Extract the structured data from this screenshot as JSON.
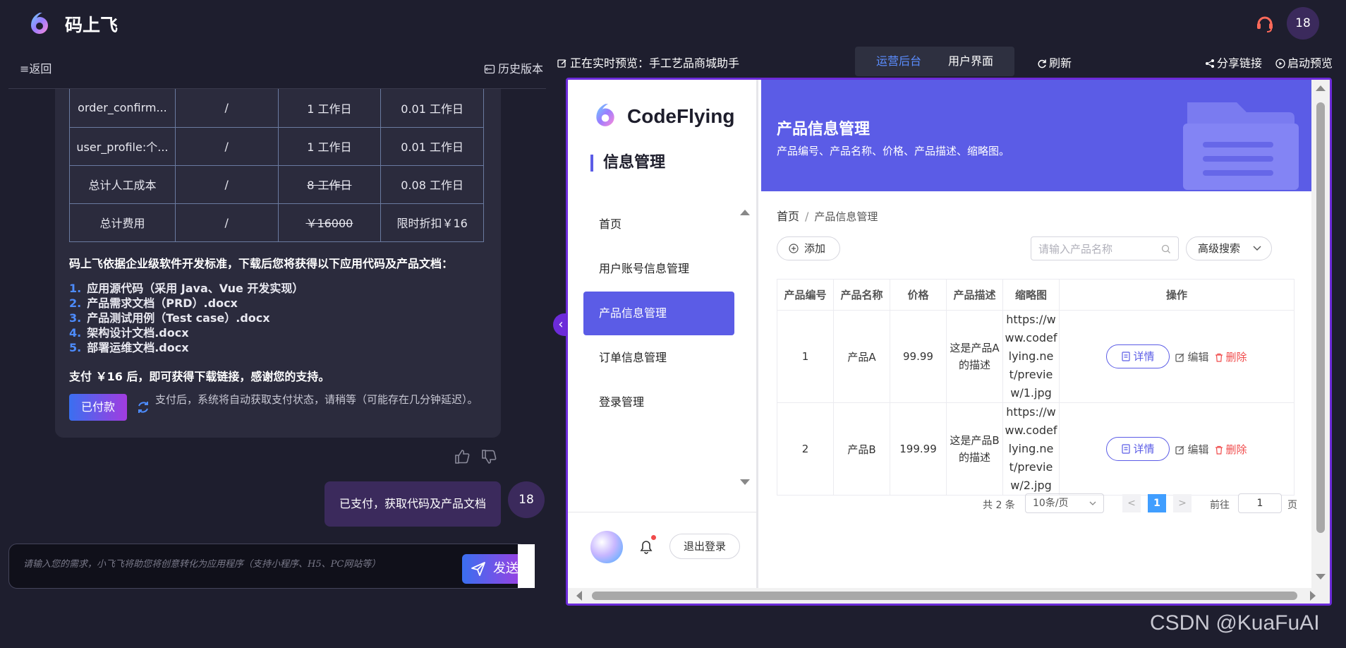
{
  "app": {
    "brand": "码上飞",
    "user_badge": "18"
  },
  "left_panel": {
    "back_label": "≡返回",
    "history_label": "历史版本",
    "cost_table": [
      [
        "order_confirm...",
        "/",
        "1 工作日",
        "0.01 工作日"
      ],
      [
        "user_profile:个...",
        "/",
        "1 工作日",
        "0.01 工作日"
      ],
      [
        "总计人工成本",
        "/",
        "8 工作日",
        "0.08 工作日"
      ],
      [
        "总计费用",
        "/",
        "￥16000",
        "限时折扣￥16"
      ]
    ],
    "intro": "码上飞依据企业级软件开发标准，下载后您将获得以下应用代码及产品文档：",
    "docs": [
      {
        "num": "1.",
        "text": "应用源代码（采用 Java、Vue 开发实现）"
      },
      {
        "num": "2.",
        "text": "产品需求文档（PRD）.docx"
      },
      {
        "num": "3.",
        "text": "产品测试用例（Test case）.docx"
      },
      {
        "num": "4.",
        "text": "架构设计文档.docx"
      },
      {
        "num": "5.",
        "text": "部署运维文档.docx"
      }
    ],
    "pay_note": "支付 ￥16 后，即可获得下载链接，感谢您的支持。",
    "paid_button": "已付款",
    "wait_text": "支付后，系统将自动获取支付状态，请稍等（可能存在几分钟延迟）。",
    "user_message": "已支付，获取代码及产品文档",
    "user_avatar": "18",
    "input_placeholder": "请输入您的需求，小飞飞将助您将创意转化为应用程序（支持小程序、H5、PC网站等）",
    "send_label": "发送"
  },
  "right_header": {
    "live_label": "正在实时预览：手工艺品商城助手",
    "tab_admin": "运营后台",
    "tab_user": "用户界面",
    "refresh_label": "刷新",
    "share_label": "分享链接",
    "preview_label": "启动预览"
  },
  "preview": {
    "brand": "CodeFlying",
    "section_title": "信息管理",
    "nav": [
      "首页",
      "用户账号信息管理",
      "产品信息管理",
      "订单信息管理",
      "登录管理"
    ],
    "logout_label": "退出登录",
    "banner_title": "产品信息管理",
    "banner_sub": "产品编号、产品名称、价格、产品描述、缩略图。",
    "breadcrumb_home": "首页",
    "breadcrumb_sep": "/",
    "breadcrumb_current": "产品信息管理",
    "add_label": "添加",
    "search_placeholder": "请输入产品名称",
    "advanced_search": "高级搜索",
    "table_headers": [
      "产品编号",
      "产品名称",
      "价格",
      "产品描述",
      "缩略图",
      "操作"
    ],
    "rows": [
      {
        "id": "1",
        "name": "产品A",
        "price": "99.99",
        "desc": "这是产品A的描述",
        "thumb": "https://www.codeflying.net/preview/1.jpg"
      },
      {
        "id": "2",
        "name": "产品B",
        "price": "199.99",
        "desc": "这是产品B的描述",
        "thumb": "https://www.codeflying.net/preview/2.jpg"
      }
    ],
    "detail_label": "详情",
    "edit_label": "编辑",
    "delete_label": "删除",
    "pager": {
      "total": "共 2 条",
      "page_size": "10条/页",
      "prev": "<",
      "current_page": "1",
      "next": ">",
      "goto_label": "前往",
      "goto_value": "1",
      "page_unit": "页"
    }
  },
  "watermark": "CSDN @KuaFuAI",
  "colors": {
    "accent_purple": "#5b5ce6",
    "frame_border": "#6c2bd9",
    "delete_red": "#f04b4b",
    "page_active": "#409eff"
  }
}
